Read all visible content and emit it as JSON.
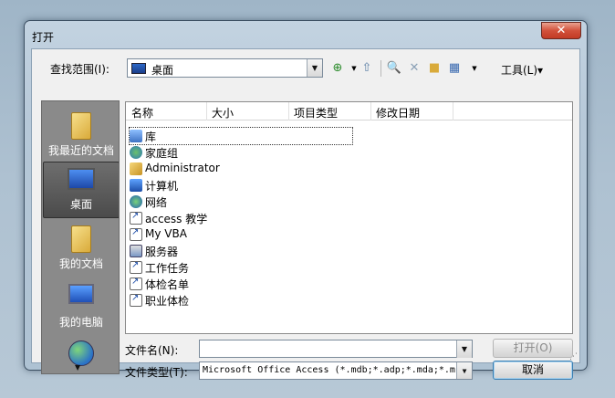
{
  "window": {
    "title": "打开",
    "close_glyph": "✕"
  },
  "lookin": {
    "label": "查找范围(I):",
    "value": "桌面"
  },
  "toolbar": {
    "back_glyph": "◀",
    "up_glyph": "▲",
    "tools_label": "工具(L)▾"
  },
  "places": [
    {
      "label": "我最近的文档",
      "icon": "folder-icon"
    },
    {
      "label": "桌面",
      "icon": "desktop-icon",
      "selected": true
    },
    {
      "label": "我的文档",
      "icon": "folder-icon"
    },
    {
      "label": "我的电脑",
      "icon": "computer-icon"
    },
    {
      "label": "",
      "icon": "network-icon"
    }
  ],
  "columns": [
    "名称",
    "大小",
    "项目类型",
    "修改日期"
  ],
  "files": [
    {
      "name": "库",
      "icon": "library-icon"
    },
    {
      "name": "家庭组",
      "icon": "homegroup-icon"
    },
    {
      "name": "Administrator",
      "icon": "user-folder-icon"
    },
    {
      "name": "计算机",
      "icon": "computer-icon"
    },
    {
      "name": "网络",
      "icon": "network-icon"
    },
    {
      "name": "access 教学",
      "icon": "shortcut-icon"
    },
    {
      "name": "My VBA",
      "icon": "shortcut-icon"
    },
    {
      "name": "服务器",
      "icon": "server-icon"
    },
    {
      "name": "工作任务",
      "icon": "shortcut-icon"
    },
    {
      "name": "体检名单",
      "icon": "shortcut-icon"
    },
    {
      "name": "职业体检",
      "icon": "shortcut-icon"
    }
  ],
  "filename": {
    "label": "文件名(N):",
    "value": ""
  },
  "filetype": {
    "label": "文件类型(T):",
    "value": "Microsoft Office Access (*.mdb;*.adp;*.mda;*.m"
  },
  "buttons": {
    "open": "打开(O)",
    "cancel": "取消"
  },
  "colors": {
    "close_red": "#d2513b",
    "selection_gray": "#4b4b4b"
  }
}
